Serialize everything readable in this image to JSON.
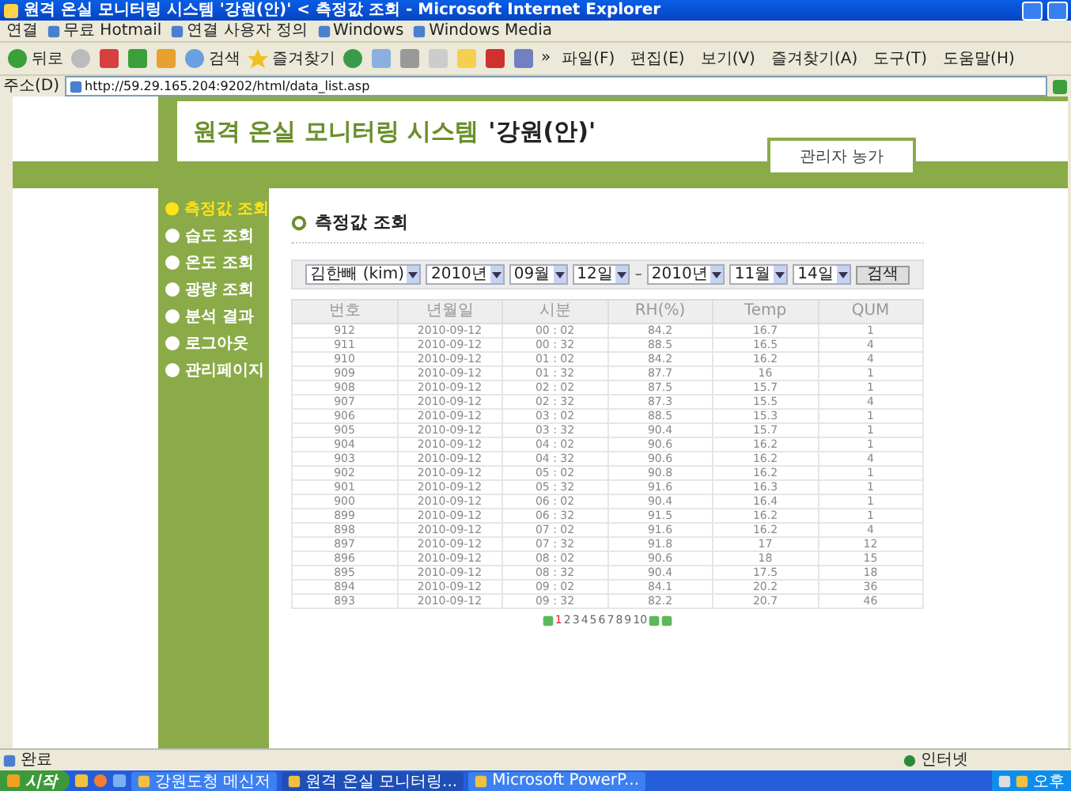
{
  "window": {
    "title": "원격 온실 모니터링 시스템 '강원(안)' < 측정값 조회 - Microsoft Internet Explorer"
  },
  "links_bar": {
    "label": "연결",
    "links": [
      "무료 Hotmail",
      "연결 사용자 정의",
      "Windows",
      "Windows Media"
    ]
  },
  "toolbar": {
    "back": "뒤로",
    "search": "검색",
    "favorites": "즐겨찾기",
    "more": "»"
  },
  "menu": [
    "파일(F)",
    "편집(E)",
    "보기(V)",
    "즐겨찾기(A)",
    "도구(T)",
    "도움말(H)"
  ],
  "address_bar": {
    "label": "주소(D)",
    "value": "http://59.29.165.204:9202/html/data_list.asp"
  },
  "header": {
    "title": "원격 온실 모니터링 시스템",
    "site": "'강원(안)'",
    "user": "관리자 농가"
  },
  "sidebar": {
    "items": [
      {
        "label": "측정값 조회",
        "selected": true
      },
      {
        "label": "습도 조회",
        "selected": false
      },
      {
        "label": "온도 조회",
        "selected": false
      },
      {
        "label": "광량 조회",
        "selected": false
      },
      {
        "label": "분석 결과",
        "selected": false
      },
      {
        "label": "로그아웃",
        "selected": false
      },
      {
        "label": "관리페이지",
        "selected": false
      }
    ]
  },
  "content": {
    "heading": "측정값 조회",
    "filters": {
      "from": [
        "김한빼 (kim)",
        "2010년",
        "09월",
        "12일"
      ],
      "separator": "–",
      "to": [
        "2010년",
        "11월",
        "14일"
      ],
      "button": "검색"
    },
    "table": {
      "columns": [
        "번호",
        "년월일",
        "시분",
        "RH(%)",
        "Temp",
        "QUM"
      ],
      "rows": [
        [
          "912",
          "2010-09-12",
          "00 : 02",
          "84.2",
          "16.7",
          "1"
        ],
        [
          "911",
          "2010-09-12",
          "00 : 32",
          "88.5",
          "16.5",
          "4"
        ],
        [
          "910",
          "2010-09-12",
          "01 : 02",
          "84.2",
          "16.2",
          "4"
        ],
        [
          "909",
          "2010-09-12",
          "01 : 32",
          "87.7",
          "16",
          "1"
        ],
        [
          "908",
          "2010-09-12",
          "02 : 02",
          "87.5",
          "15.7",
          "1"
        ],
        [
          "907",
          "2010-09-12",
          "02 : 32",
          "87.3",
          "15.5",
          "4"
        ],
        [
          "906",
          "2010-09-12",
          "03 : 02",
          "88.5",
          "15.3",
          "1"
        ],
        [
          "905",
          "2010-09-12",
          "03 : 32",
          "90.4",
          "15.7",
          "1"
        ],
        [
          "904",
          "2010-09-12",
          "04 : 02",
          "90.6",
          "16.2",
          "1"
        ],
        [
          "903",
          "2010-09-12",
          "04 : 32",
          "90.6",
          "16.2",
          "4"
        ],
        [
          "902",
          "2010-09-12",
          "05 : 02",
          "90.8",
          "16.2",
          "1"
        ],
        [
          "901",
          "2010-09-12",
          "05 : 32",
          "91.6",
          "16.3",
          "1"
        ],
        [
          "900",
          "2010-09-12",
          "06 : 02",
          "90.4",
          "16.4",
          "1"
        ],
        [
          "899",
          "2010-09-12",
          "06 : 32",
          "91.5",
          "16.2",
          "1"
        ],
        [
          "898",
          "2010-09-12",
          "07 : 02",
          "91.6",
          "16.2",
          "4"
        ],
        [
          "897",
          "2010-09-12",
          "07 : 32",
          "91.8",
          "17",
          "12"
        ],
        [
          "896",
          "2010-09-12",
          "08 : 02",
          "90.6",
          "18",
          "15"
        ],
        [
          "895",
          "2010-09-12",
          "08 : 32",
          "90.4",
          "17.5",
          "18"
        ],
        [
          "894",
          "2010-09-12",
          "09 : 02",
          "84.1",
          "20.2",
          "36"
        ],
        [
          "893",
          "2010-09-12",
          "09 : 32",
          "82.2",
          "20.7",
          "46"
        ]
      ]
    },
    "pagination": [
      {
        "label": "1",
        "selected": true
      },
      {
        "label": "2",
        "selected": false
      },
      {
        "label": "3",
        "selected": false
      },
      {
        "label": "4",
        "selected": false
      },
      {
        "label": "5",
        "selected": false
      },
      {
        "label": "6",
        "selected": false
      },
      {
        "label": "7",
        "selected": false
      },
      {
        "label": "8",
        "selected": false
      },
      {
        "label": "9",
        "selected": false
      },
      {
        "label": "10",
        "selected": false
      }
    ]
  },
  "status_bar": {
    "status": "완료",
    "zone": "인터넷"
  },
  "taskbar": {
    "start": "시작",
    "tasks": [
      "강원도청 메신저",
      "원격 온실 모니터링...",
      "Microsoft PowerP..."
    ],
    "clock": "오후"
  }
}
